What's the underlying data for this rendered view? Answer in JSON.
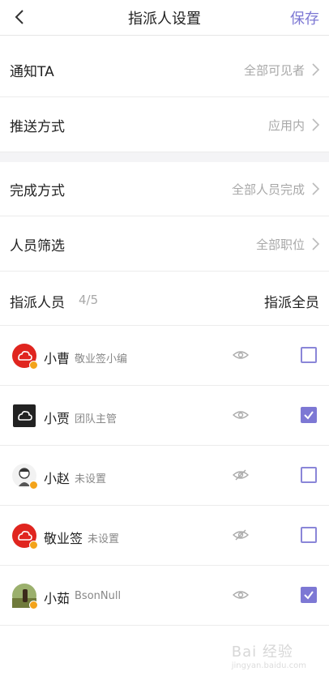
{
  "header": {
    "title": "指派人设置",
    "save_label": "保存"
  },
  "settings": [
    {
      "label": "通知TA",
      "value": "全部可见者"
    },
    {
      "label": "推送方式",
      "value": "应用内"
    },
    {
      "label": "完成方式",
      "value": "全部人员完成"
    },
    {
      "label": "人员筛选",
      "value": "全部职位"
    }
  ],
  "assign": {
    "label": "指派人员",
    "count": "4/5",
    "all_label": "指派全员"
  },
  "members": [
    {
      "name": "小曹",
      "role": "敬业签小编",
      "visible": true,
      "checked": false,
      "avatar": "red-cloud"
    },
    {
      "name": "小贾",
      "role": "团队主管",
      "visible": true,
      "checked": true,
      "avatar": "dark-cloud"
    },
    {
      "name": "小赵",
      "role": "未设置",
      "visible": false,
      "checked": false,
      "avatar": "cartoon-person"
    },
    {
      "name": "敬业签",
      "role": "未设置",
      "visible": false,
      "checked": false,
      "avatar": "red-cloud"
    },
    {
      "name": "小茹",
      "role": "BsonNull",
      "visible": true,
      "checked": true,
      "avatar": "photo"
    }
  ],
  "watermark": {
    "text": "Bai 经验",
    "sub": "jingyan.baidu.com"
  },
  "colors": {
    "accent": "#7d78d4",
    "red_avatar": "#e0251f",
    "badge": "#f3a31a"
  }
}
